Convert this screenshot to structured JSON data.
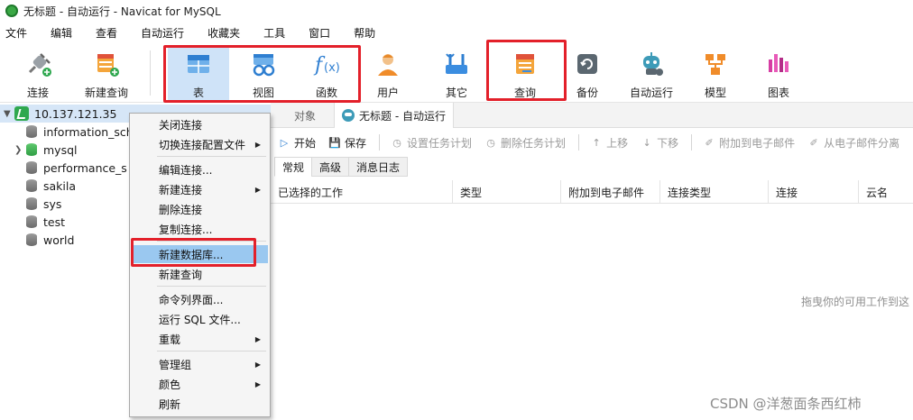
{
  "window": {
    "title": "无标题 - 自动运行 - Navicat for MySQL"
  },
  "menubar": [
    "文件",
    "编辑",
    "查看",
    "自动运行",
    "收藏夹",
    "工具",
    "窗口",
    "帮助"
  ],
  "toolbar": {
    "connect": "连接",
    "new_query": "新建查询",
    "table": "表",
    "view": "视图",
    "function": "函数",
    "user": "用户",
    "other": "其它",
    "query": "查询",
    "backup": "备份",
    "automation": "自动运行",
    "model": "模型",
    "chart": "图表"
  },
  "colors": {
    "highlight_box": "#e3202a",
    "selection": "#cfe3f8",
    "menu_hover": "#9ac8f0",
    "connection": "#2fa84f"
  },
  "tree": {
    "connection": "10.137.121.35",
    "databases": [
      "information_sch",
      "mysql",
      "performance_s",
      "sakila",
      "sys",
      "test",
      "world"
    ]
  },
  "context_menu": [
    "关闭连接",
    "切换连接配置文件",
    "编辑连接...",
    "新建连接",
    "删除连接",
    "复制连接...",
    "新建数据库...",
    "新建查询",
    "命令列界面...",
    "运行 SQL 文件...",
    "重载",
    "管理组",
    "颜色",
    "刷新"
  ],
  "tabs": {
    "objects": "对象",
    "automation_tab": "无标题 - 自动运行"
  },
  "actions": {
    "start": "开始",
    "save": "保存",
    "set_schedule": "设置任务计划",
    "delete_schedule": "删除任务计划",
    "move_up": "上移",
    "move_down": "下移",
    "attach_email": "附加到电子邮件",
    "detach_email": "从电子邮件分离"
  },
  "subtabs": [
    "常规",
    "高级",
    "消息日志"
  ],
  "columns": [
    "已选择的工作",
    "类型",
    "附加到电子邮件",
    "连接类型",
    "连接",
    "云名"
  ],
  "drag_hint": "拖曳你的可用工作到这",
  "watermark": "CSDN @洋葱面条西红柿"
}
